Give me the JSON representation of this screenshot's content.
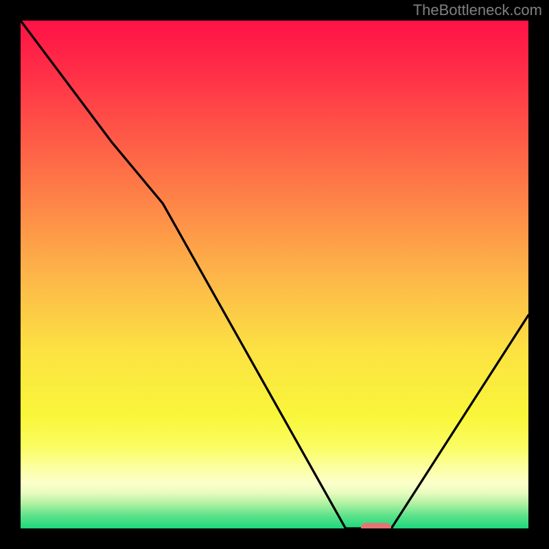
{
  "watermark": "TheBottleneck.com",
  "chart_data": {
    "type": "line",
    "title": "",
    "xlabel": "",
    "ylabel": "",
    "x": [
      0,
      18,
      28,
      64,
      68,
      73,
      100
    ],
    "values": [
      100,
      76,
      64,
      0,
      0,
      0,
      42
    ],
    "ylim": [
      0,
      100
    ],
    "xlim": [
      0,
      100
    ],
    "marker": {
      "x": 70,
      "y": 0
    },
    "gradient_stops": [
      {
        "pos": 0,
        "color": "#ff1246"
      },
      {
        "pos": 0.1,
        "color": "#ff2e47"
      },
      {
        "pos": 0.3,
        "color": "#fe7147"
      },
      {
        "pos": 0.5,
        "color": "#fdb549"
      },
      {
        "pos": 0.65,
        "color": "#fce242"
      },
      {
        "pos": 0.78,
        "color": "#f9f63a"
      },
      {
        "pos": 0.84,
        "color": "#fafd63"
      },
      {
        "pos": 0.88,
        "color": "#fcffa0"
      },
      {
        "pos": 0.91,
        "color": "#fcffc9"
      },
      {
        "pos": 0.93,
        "color": "#e8fcc0"
      },
      {
        "pos": 0.95,
        "color": "#b3f2a3"
      },
      {
        "pos": 0.975,
        "color": "#5de28a"
      },
      {
        "pos": 1.0,
        "color": "#1cd77c"
      }
    ]
  }
}
